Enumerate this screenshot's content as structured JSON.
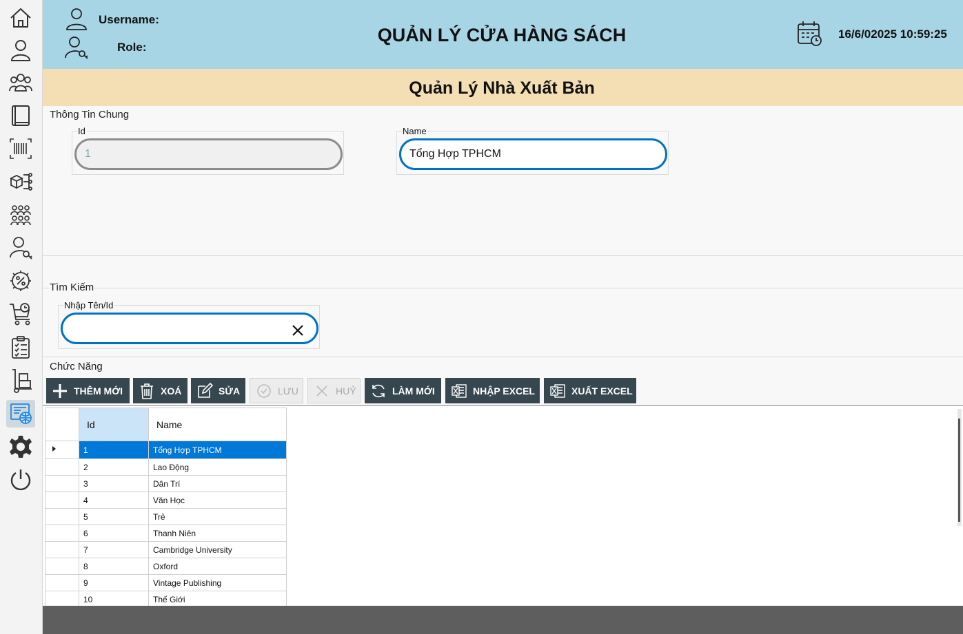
{
  "header": {
    "username_label": "Username:",
    "role_label": "Role:",
    "app_title": "QUẢN LÝ CỬA HÀNG SÁCH",
    "datetime": "16/6/02025 10:59:25"
  },
  "page_title": "Quản Lý Nhà Xuất Bản",
  "general_info": {
    "title": "Thông Tin Chung",
    "id_label": "Id",
    "id_value": "1",
    "name_label": "Name",
    "name_value": "Tổng Hợp TPHCM"
  },
  "search": {
    "title": "Tìm Kiếm",
    "label": "Nhập Tên/Id",
    "value": ""
  },
  "functions": {
    "title": "Chức Năng",
    "buttons": {
      "add": "THÊM MỚI",
      "delete": "XOÁ",
      "edit": "SỬA",
      "save": "LƯU",
      "cancel": "HUỶ",
      "refresh": "LÀM MỚI",
      "import": "NHẬP EXCEL",
      "export": "XUẤT EXCEL"
    }
  },
  "table": {
    "columns": [
      "Id",
      "Name"
    ],
    "rows": [
      {
        "id": "1",
        "name": "Tổng Hợp TPHCM"
      },
      {
        "id": "2",
        "name": "Lao Động"
      },
      {
        "id": "3",
        "name": "Dân Trí"
      },
      {
        "id": "4",
        "name": "Văn Học"
      },
      {
        "id": "5",
        "name": "Trẻ"
      },
      {
        "id": "6",
        "name": "Thanh Niên"
      },
      {
        "id": "7",
        "name": "Cambridge University"
      },
      {
        "id": "8",
        "name": "Oxford"
      },
      {
        "id": "9",
        "name": "Vintage Publishing"
      },
      {
        "id": "10",
        "name": "Thế Giới"
      }
    ],
    "selected_row": 0
  },
  "colors": {
    "header_bg": "#a8d5e5",
    "subheader_bg": "#f4deb4",
    "button_bg": "#37474f",
    "accent": "#0072c6",
    "selection": "#0078d7"
  }
}
